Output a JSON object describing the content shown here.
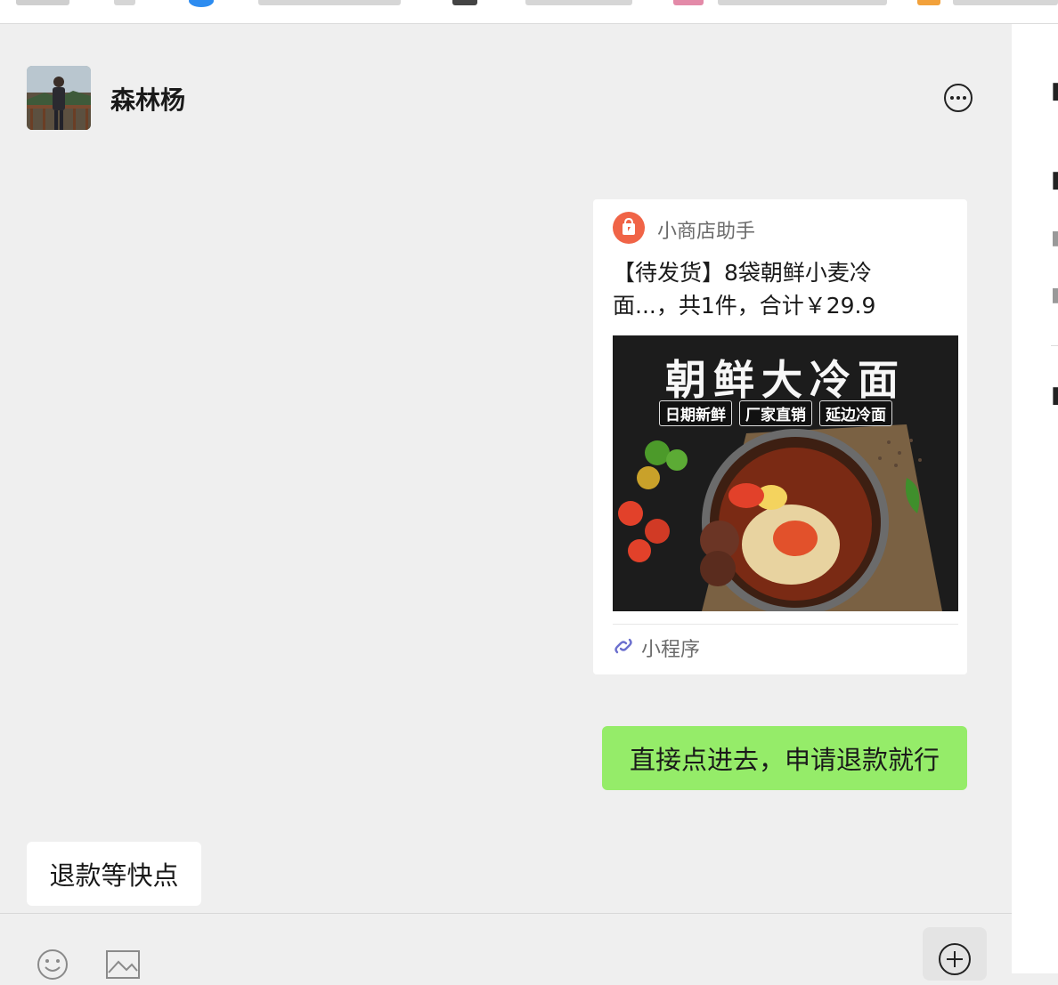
{
  "header": {
    "contact_name": "森林杨",
    "more_icon": "more-icon"
  },
  "messages": {
    "card": {
      "app_name": "小商店助手",
      "app_icon": "shop-bag-icon",
      "app_icon_color": "#f06447",
      "title_line1": "【待发货】8袋朝鲜小麦冷",
      "title_line2": "面...，共1件，合计￥29.9",
      "image": {
        "headline": "朝鲜大冷面",
        "tags": [
          "日期新鲜",
          "厂家直销",
          "延边冷面"
        ]
      },
      "footer_label": "小程序",
      "footer_icon": "mini-program-icon"
    },
    "sent_text": "直接点进去，申请退款就行",
    "received_text": "退款等快点"
  },
  "colors": {
    "sent_bubble": "#95ec69",
    "received_bubble": "#ffffff",
    "chat_background": "#efefef"
  },
  "toolbar": {
    "emoji_icon": "emoji-icon",
    "image_icon": "image-icon",
    "plus_icon": "plus-icon"
  }
}
